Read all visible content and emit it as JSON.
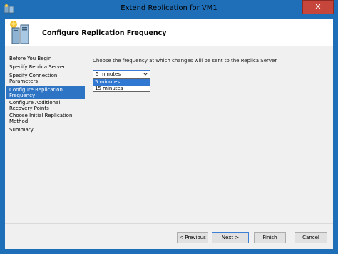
{
  "window": {
    "title": "Extend Replication for VM1",
    "close_glyph": "✕",
    "accent": "#1e6fb8"
  },
  "header": {
    "title": "Configure Replication Frequency"
  },
  "steps": [
    {
      "label": "Before You Begin",
      "selected": false
    },
    {
      "label": "Specify Replica Server",
      "selected": false
    },
    {
      "label": "Specify Connection",
      "label2": "Parameters",
      "selected": false
    },
    {
      "label": "Configure Replication",
      "label2": "Frequency",
      "selected": true
    },
    {
      "label": "Configure Additional",
      "label2": "Recovery Points",
      "selected": false
    },
    {
      "label": "Choose Initial Replication",
      "label2": "Method",
      "selected": false
    },
    {
      "label": "Summary",
      "selected": false
    }
  ],
  "main": {
    "prompt": "Choose the frequency at which changes will be sent to the Replica Server",
    "frequency": {
      "selected": "5 minutes",
      "options": [
        "5 minutes",
        "15 minutes"
      ]
    }
  },
  "buttons": {
    "previous": "< Previous",
    "next": "Next >",
    "finish": "Finish",
    "cancel": "Cancel"
  }
}
